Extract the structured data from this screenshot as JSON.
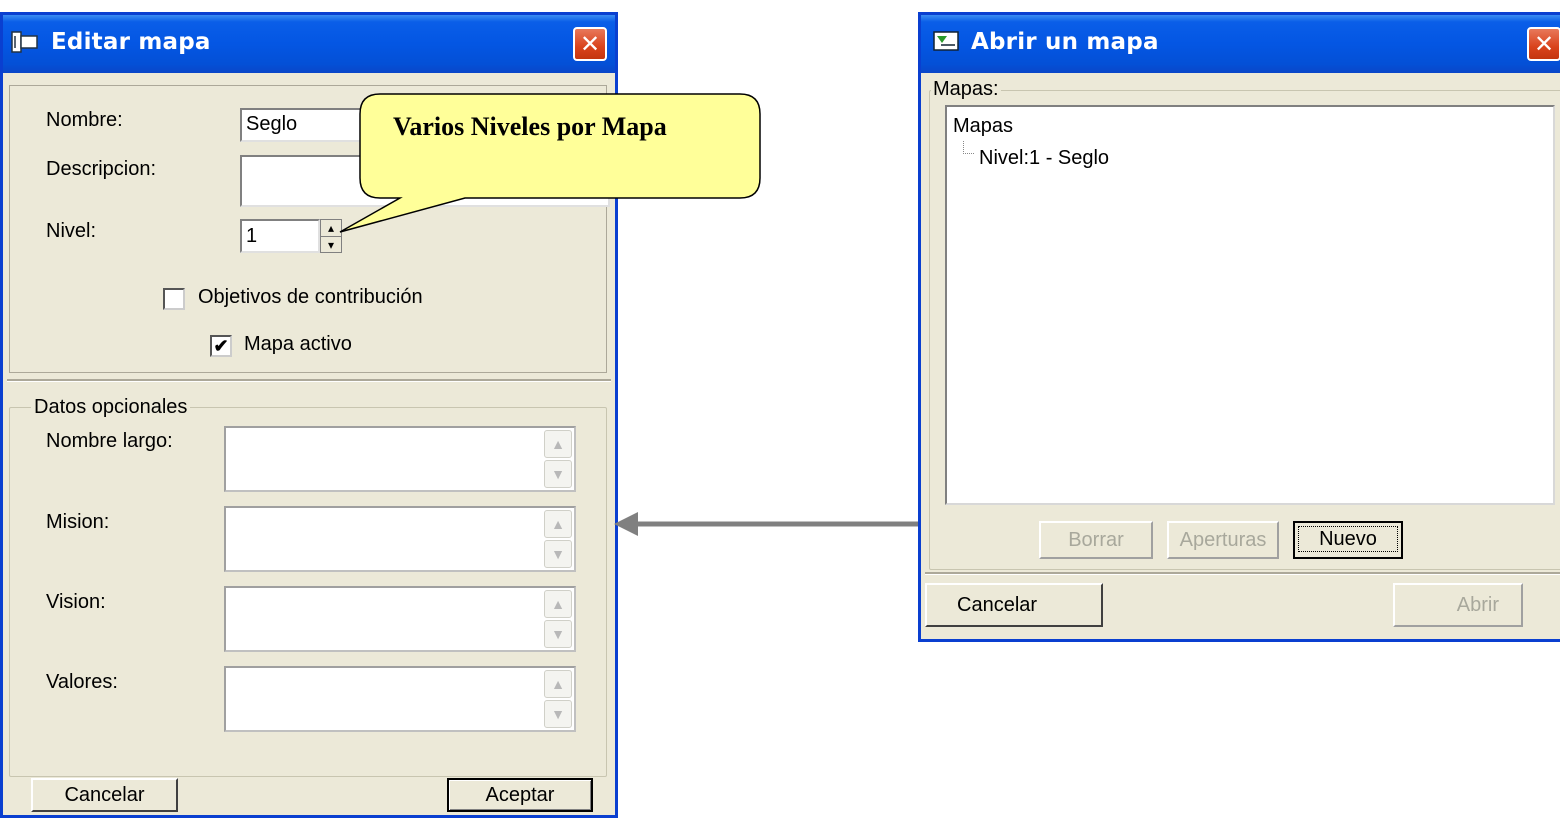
{
  "edit_window": {
    "title": "Editar mapa",
    "close_glyph": "✕",
    "nombre_label": "Nombre:",
    "nombre_value": "Seglo",
    "descripcion_label": "Descripcion:",
    "nivel_label": "Nivel:",
    "nivel_value": "1",
    "contribucion_label": "Objetivos de contribución",
    "contribucion_checked": false,
    "activo_label": "Mapa activo",
    "activo_checked": true,
    "activo_check_glyph": "✔",
    "optional_group": "Datos opcionales",
    "nombre_largo_label": "Nombre largo:",
    "mision_label": "Mision:",
    "vision_label": "Vision:",
    "valores_label": "Valores:",
    "cancel_label": "Cancelar",
    "accept_label": "Aceptar"
  },
  "callout": {
    "text": "Varios Niveles por Mapa",
    "fill": "#ffff99"
  },
  "open_window": {
    "title": "Abrir un mapa",
    "close_glyph": "✕",
    "group_label": "Mapas:",
    "tree_root": "Mapas",
    "tree_child": "Nivel:1 - Seglo",
    "borrar_label": "Borrar",
    "aperturas_label": "Aperturas",
    "nuevo_label": "Nuevo",
    "cancel_label": "Cancelar",
    "abrir_label": "Abrir"
  },
  "colors": {
    "titlebar_blue": "#0456e3",
    "window_face": "#ece9d8",
    "arrow_gray": "#808080"
  },
  "icons": {
    "up_arrow": "▲",
    "down_arrow": "▼",
    "spin_up": "▴",
    "spin_down": "▾"
  }
}
